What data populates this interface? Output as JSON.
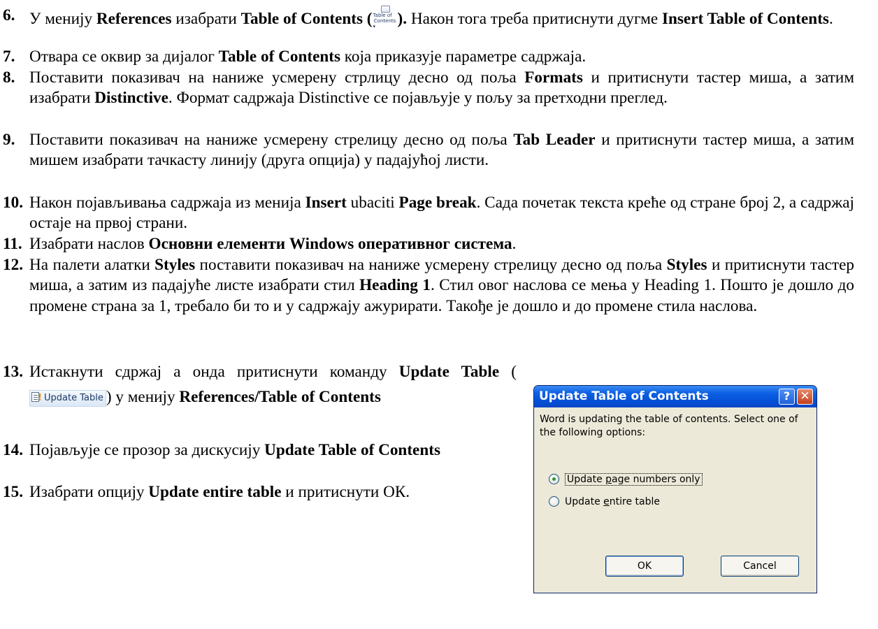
{
  "items": [
    {
      "num": "6.",
      "a": "У менију ",
      "b": "References",
      "c": " изабрати ",
      "d": "Table of Contents (",
      "e": ").",
      "f": " Након тога треба притиснути дугме ",
      "g": "Insert Table of Contents",
      "h": "."
    },
    {
      "num": "7.",
      "a": "Отвара се оквир за дијалог ",
      "b": "Table of Contents",
      "c": " која приказује параметре садржаја."
    },
    {
      "num": "8.",
      "a": "Поставити показивач на наниже усмерену стрлицу десно од поља ",
      "b": "Formats",
      "c": " и притиснути тастер миша, а затим изабрати ",
      "d": "Distinctive",
      "e": ". Формат садржаја Distinctive се појављује у пољу за претходни преглед."
    },
    {
      "num": "9.",
      "a": "Поставити показивач на наниже усмерену стрелицу десно од поља ",
      "b": "Tab Leader",
      "c": " и притиснути тастер миша, а затим мишем изабрати тачкасту линију (друга опција) у падајућој листи."
    },
    {
      "num": "10.",
      "a": "Након појављивања садржаја из менија ",
      "b": "Insert",
      "c": " ubaciti ",
      "d": "Page break",
      "e": ". Сада почетак текста креће од стране број 2, а садржај остаје на првој страни."
    },
    {
      "num": "11.",
      "a": "Изабрати наслов ",
      "b": "Основни елементи Windows оперативног система",
      "c": "."
    },
    {
      "num": "12.",
      "a": "На палети алатки ",
      "b": "Styles",
      "c": " поставити показивач на наниже усмерену стрелицу десно од поља ",
      "d": "Styles",
      "e": " и притиснути тастер миша, а затим из падајуће листе изабрати стил ",
      "f": "Heading 1",
      "g": ". Стил овог наслова се мења у Heading 1. Пошто је дошло до промене страна за 1, требало би то и у садржају ажурирати. Такође је дошло и до промене стила наслова."
    },
    {
      "num": "13.",
      "a": "Истакнути сдржај а онда притиснути команду ",
      "b": "Update Table",
      "c": " (",
      "d": ") у менију ",
      "e": "References/Table of Contents"
    },
    {
      "num": "14.",
      "a": "Појављује се прозор за дискусију ",
      "b": "Update Table of Contents"
    },
    {
      "num": "15.",
      "a": "Изабрати опцију ",
      "b": "Update entire table",
      "c": " и притиснути ОК."
    }
  ],
  "toc_icon": {
    "line1": "Table of",
    "line2": "Contents ▾",
    "icon": "table-of-contents-icon"
  },
  "update_button": {
    "label": "Update Table",
    "icon": "update-table-icon"
  },
  "dialog": {
    "title": "Update Table of Contents",
    "help": "?",
    "close": "✕",
    "message": "Word is updating the table of contents.  Select one of the following options:",
    "options": [
      {
        "pre": "Update ",
        "key": "p",
        "post": "age numbers only",
        "selected": true
      },
      {
        "pre": "Update ",
        "key": "e",
        "post": "ntire table",
        "selected": false
      }
    ],
    "ok": "OK",
    "cancel": "Cancel"
  }
}
